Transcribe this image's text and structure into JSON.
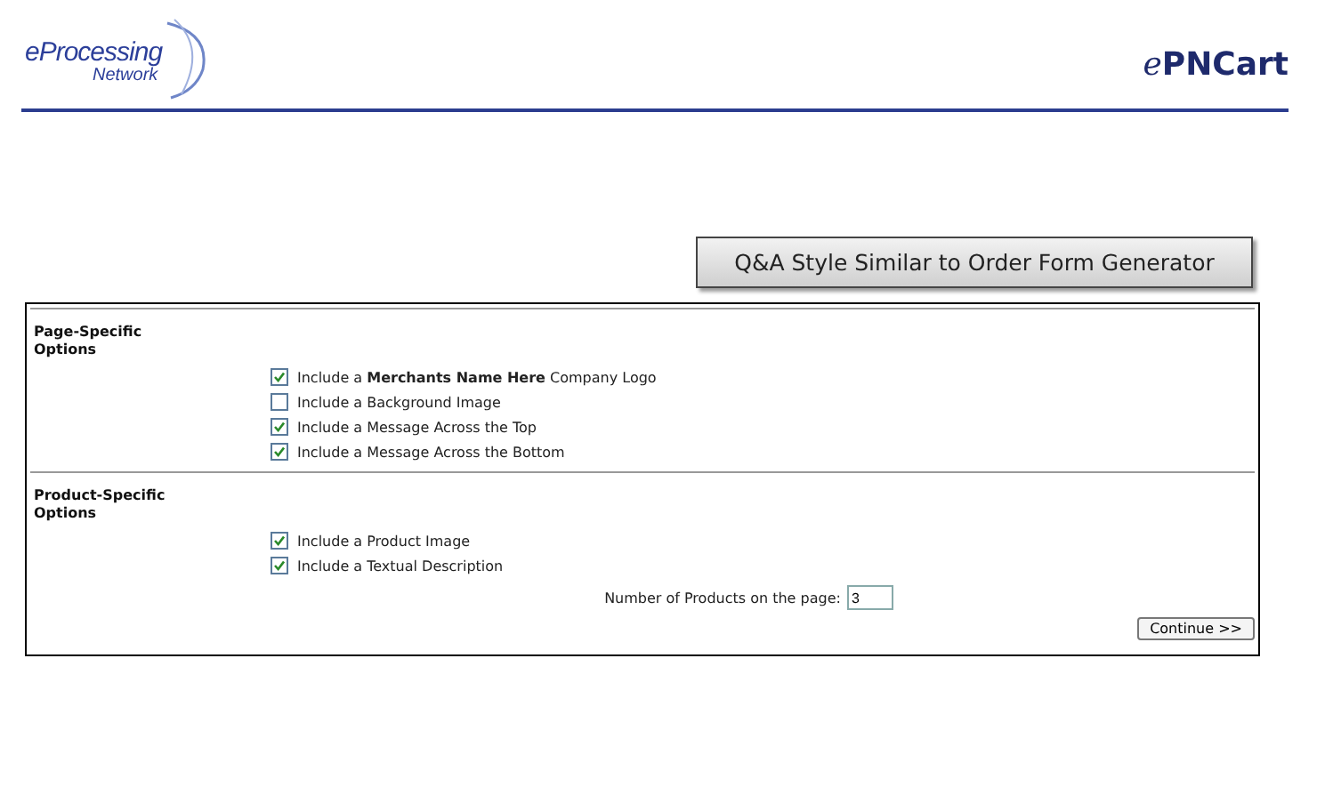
{
  "logo": {
    "line_1": "eProcessing",
    "line_2": "Network"
  },
  "brand": {
    "prefix": "e",
    "name": "PNCart"
  },
  "banner": "Q&A Style Similar to Order Form Generator",
  "sections": [
    {
      "heading": [
        "Page-Specific",
        "Options"
      ],
      "options": [
        {
          "label": "Include a **Merchants Name Here** Company Logo",
          "checked": true
        },
        {
          "label": "Include a Background Image",
          "checked": false
        },
        {
          "label": "Include a Message Across the Top",
          "checked": true
        },
        {
          "label": "Include a Message Across the Bottom",
          "checked": true
        }
      ]
    },
    {
      "heading": [
        "Product-Specific",
        "Options"
      ],
      "options": [
        {
          "label": "Include a Product Image",
          "checked": true
        },
        {
          "label": "Include a Textual Description",
          "checked": true
        }
      ]
    }
  ],
  "products_field": {
    "label": "Number of Products on the page:",
    "value": "3"
  },
  "continue_button": "Continue >>"
}
